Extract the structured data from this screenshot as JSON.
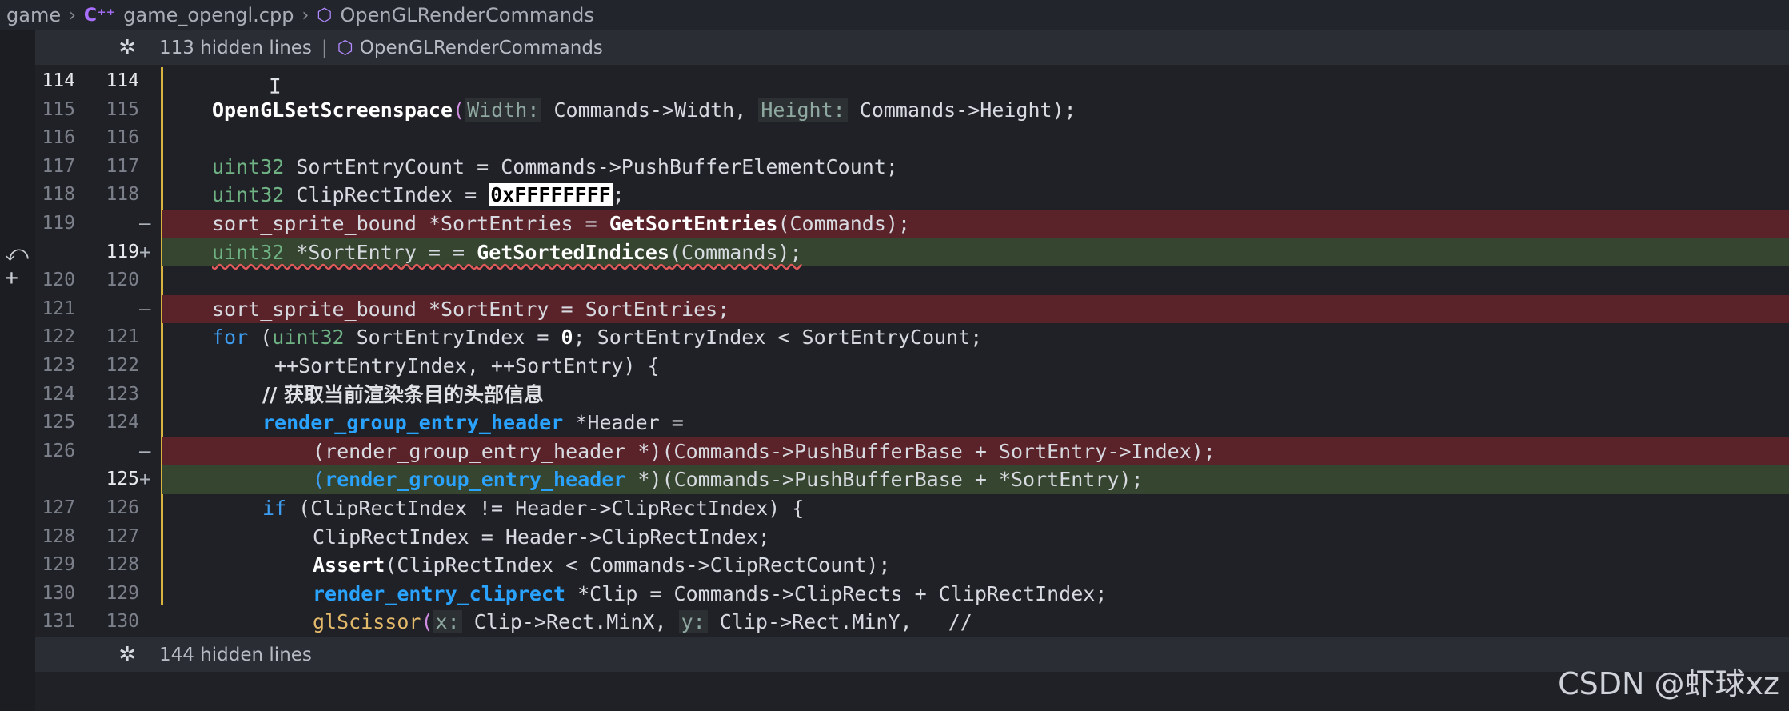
{
  "breadcrumb": {
    "root": "game",
    "file_icon": "C++ file icon",
    "file": "game_opengl.cpp",
    "symbol": "OpenGLRenderCommands"
  },
  "hidden_top": {
    "label": "113 hidden lines",
    "separator": "|",
    "symbol": "OpenGLRenderCommands"
  },
  "hidden_bottom": {
    "label": "144 hidden lines"
  },
  "lines": [
    {
      "left": "114",
      "right": "114",
      "mark": ""
    },
    {
      "left": "115",
      "right": "115",
      "mark": ""
    },
    {
      "left": "116",
      "right": "116",
      "mark": ""
    },
    {
      "left": "117",
      "right": "117",
      "mark": ""
    },
    {
      "left": "118",
      "right": "118",
      "mark": ""
    },
    {
      "left": "119",
      "right": "",
      "mark": "—"
    },
    {
      "left": "",
      "right": "119",
      "mark": "+"
    },
    {
      "left": "120",
      "right": "120",
      "mark": ""
    },
    {
      "left": "121",
      "right": "",
      "mark": "—"
    },
    {
      "left": "122",
      "right": "121",
      "mark": ""
    },
    {
      "left": "123",
      "right": "122",
      "mark": ""
    },
    {
      "left": "124",
      "right": "123",
      "mark": ""
    },
    {
      "left": "125",
      "right": "124",
      "mark": ""
    },
    {
      "left": "126",
      "right": "",
      "mark": "—"
    },
    {
      "left": "",
      "right": "125",
      "mark": "+"
    },
    {
      "left": "127",
      "right": "126",
      "mark": ""
    },
    {
      "left": "128",
      "right": "127",
      "mark": ""
    },
    {
      "left": "129",
      "right": "128",
      "mark": ""
    },
    {
      "left": "130",
      "right": "129",
      "mark": ""
    },
    {
      "left": "131",
      "right": "130",
      "mark": ""
    }
  ],
  "code": {
    "l115": {
      "fn": "OpenGLSetScreenspace",
      "h1": "Width:",
      "a1": "Commands->Width, ",
      "h2": "Height:",
      "a2": "Commands->Height);"
    },
    "l117": {
      "ty": "uint32",
      "rest": " SortEntryCount = Commands->PushBufferElementCount;"
    },
    "l118": {
      "ty": "uint32",
      "rest": " ClipRectIndex = ",
      "hex": "0xFFFFFFFF",
      "end": ";"
    },
    "l119del": {
      "a": "sort_sprite_bound ",
      "b": "*SortEntries = ",
      "fn": "GetSortEntries",
      "c": "(Commands);"
    },
    "l119add": {
      "ty": "uint32",
      "a": " *SortEntry = = ",
      "fn": "GetSortedIndices",
      "c": "(Commands);"
    },
    "l121del": {
      "a": "sort_sprite_bound ",
      "b": "*SortEntry = SortEntries;"
    },
    "l122": {
      "kw": "for",
      "a": " (",
      "ty": "uint32",
      "b": " SortEntryIndex = ",
      "num": "0",
      "c": "; SortEntryIndex < SortEntryCount;"
    },
    "l123": {
      "a": "++SortEntryIndex, ++SortEntry) {"
    },
    "l124": {
      "cmt": "// 获取当前渲染条目的头部信息"
    },
    "l125": {
      "fnb": "render_group_entry_header",
      "a": " *Header ="
    },
    "l126del": {
      "a": "(render_group_entry_header *)(Commands->PushBufferBase + SortEntry->Index);"
    },
    "l125add": {
      "p": "(",
      "fnb": "render_group_entry_header",
      "a": " *)(Commands->PushBufferBase + ",
      "b": "*SortEntry);"
    },
    "l127": {
      "kw": "if",
      "a": " (ClipRectIndex != Header->ClipRectIndex) {"
    },
    "l128": {
      "a": "ClipRectIndex = Header->ClipRectIndex;"
    },
    "l129": {
      "fn": "Assert",
      "a": "(ClipRectIndex < Commands->ClipRectCount);"
    },
    "l130": {
      "fnb": "render_entry_cliprect",
      "a": " *Clip = Commands->ClipRects + ClipRectIndex;"
    },
    "l131": {
      "call": "glScissor",
      "p": "(",
      "h1": "x:",
      "a1": "Clip->Rect.MinX, ",
      "h2": "y:",
      "a2": "Clip->Rect.MinY,   //"
    }
  },
  "watermark": "CSDN @虾球xz",
  "icons": {
    "fold": "fold-icon",
    "cube": "symbol-cube-icon",
    "undo": "undo-icon",
    "plus": "plus-icon",
    "cursor": "text-cursor-icon"
  }
}
